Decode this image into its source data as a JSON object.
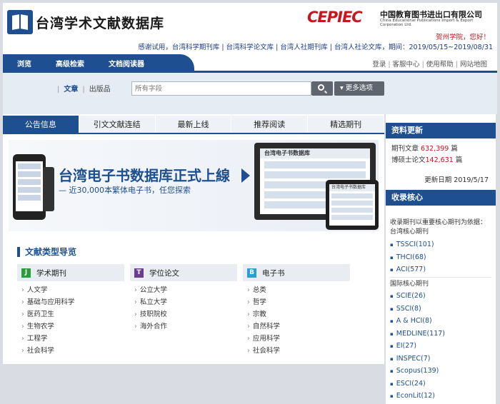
{
  "header": {
    "site_title": "台湾学术文献数据库",
    "cepiec_logo": "CEPIEC",
    "cepiec_cn": "中国教育图书进出口有限公司",
    "cepiec_en": "China Educational Publications Import & Export Corporation Ltd.",
    "greeting": "贺州学院，您好！",
    "notice_prefix": "感谢试用，",
    "notice_items": [
      "台湾科学期刊库",
      "台湾科学论文库",
      "台湾人社期刊库",
      "台湾人社论文库"
    ],
    "notice_period": "，期间：2019/05/15~2019/08/31"
  },
  "nav": {
    "left": [
      "浏览",
      "高级检索",
      "文档阅读器"
    ],
    "right": [
      "登录",
      "客服中心",
      "使用帮助",
      "网站地图"
    ]
  },
  "search": {
    "scope_active": "文章",
    "scope_other": "出版品",
    "placeholder": "所有字段",
    "more_label": "更多选项"
  },
  "tabs": [
    "公告信息",
    "引文文献连结",
    "最新上线",
    "推荐阅读",
    "精选期刊"
  ],
  "banner": {
    "title": "台湾电子书数据库正式上線",
    "subtitle": "— 近30,000本繁体电子书，任您探索",
    "screen_title": "台湾电子书数据库",
    "tablet_title": "台湾电子书数据库"
  },
  "doc_types": {
    "title": "文献类型导览",
    "columns": [
      {
        "badge": "J",
        "badge_color": "#2e9c3a",
        "label": "学术期刊",
        "items": [
          "人文学",
          "基础与应用科学",
          "医药卫生",
          "生物农学",
          "工程学",
          "社会科学"
        ]
      },
      {
        "badge": "T",
        "badge_color": "#6a3d8f",
        "label": "学位论文",
        "items": [
          "公立大学",
          "私立大学",
          "技职院校",
          "海外合作"
        ]
      },
      {
        "badge": "B",
        "badge_color": "#2a9fd6",
        "label": "电子书",
        "items": [
          "总类",
          "哲学",
          "宗教",
          "自然科学",
          "应用科学",
          "社会科学"
        ]
      }
    ]
  },
  "sidebar": {
    "update_title": "资料更新",
    "journal_label": "期刊文章",
    "journal_count": "632,399",
    "journal_unit": "篇",
    "thesis_label": "博硕士论文",
    "thesis_count": "142,631",
    "thesis_unit": "篇",
    "update_date": "更新日期 2019/5/17",
    "core_title": "收录核心",
    "core_note": "收录期刊以重要核心期刊为依据：",
    "tw_core_label": "台湾核心期刊",
    "tw_core": [
      "TSSCI(101)",
      "THCI(68)",
      "ACI(577)"
    ],
    "intl_core_label": "国际核心期刊",
    "intl_core": [
      "SCIE(26)",
      "SSCI(8)",
      "A & HCI(8)",
      "MEDLINE(117)",
      "EI(27)",
      "INSPEC(7)",
      "Scopus(139)",
      "ESCI(24)",
      "EconLit(12)"
    ]
  }
}
